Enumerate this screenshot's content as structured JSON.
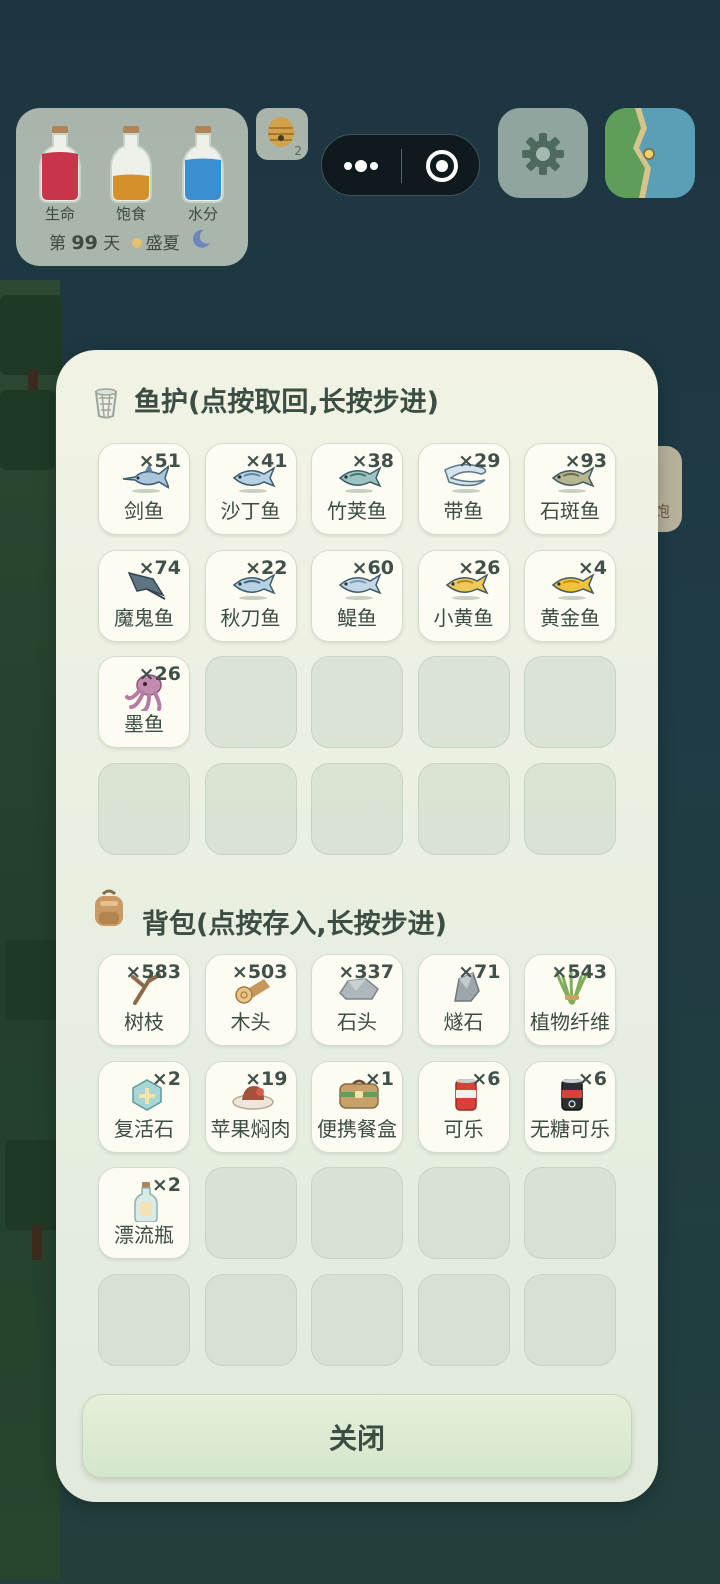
{
  "status": {
    "bottles": [
      {
        "label": "生命",
        "color": "#c8344a"
      },
      {
        "label": "饱食",
        "color": "#d4902a"
      },
      {
        "label": "水分",
        "color": "#3a8fd0"
      }
    ],
    "day_prefix": "第",
    "day_number": "99",
    "day_suffix": "天",
    "season": "盛夏"
  },
  "beehive": {
    "count": "2"
  },
  "side_panel": {
    "label": "饱"
  },
  "fish_section": {
    "title": "鱼护(点按取回,长按步进)",
    "items": [
      {
        "name": "剑鱼",
        "qty": "×51",
        "icon": "swordfish-icon"
      },
      {
        "name": "沙丁鱼",
        "qty": "×41",
        "icon": "sardine-icon"
      },
      {
        "name": "竹荚鱼",
        "qty": "×38",
        "icon": "mackerel-icon"
      },
      {
        "name": "带鱼",
        "qty": "×29",
        "icon": "beltfish-icon"
      },
      {
        "name": "石斑鱼",
        "qty": "×93",
        "icon": "grouper-icon"
      },
      {
        "name": "魔鬼鱼",
        "qty": "×74",
        "icon": "stingray-icon"
      },
      {
        "name": "秋刀鱼",
        "qty": "×22",
        "icon": "saury-icon"
      },
      {
        "name": "鳀鱼",
        "qty": "×60",
        "icon": "anchovy-icon"
      },
      {
        "name": "小黄鱼",
        "qty": "×26",
        "icon": "yellow-croaker-icon"
      },
      {
        "name": "黄金鱼",
        "qty": "×4",
        "icon": "golden-fish-icon"
      },
      {
        "name": "墨鱼",
        "qty": "×26",
        "icon": "squid-icon"
      }
    ],
    "capacity": 20
  },
  "bag_section": {
    "title": "背包(点按存入,长按步进)",
    "items": [
      {
        "name": "树枝",
        "qty": "×583",
        "icon": "branch-icon"
      },
      {
        "name": "木头",
        "qty": "×503",
        "icon": "wood-log-icon"
      },
      {
        "name": "石头",
        "qty": "×337",
        "icon": "stone-icon"
      },
      {
        "name": "燧石",
        "qty": "×71",
        "icon": "flint-icon"
      },
      {
        "name": "植物纤维",
        "qty": "×543",
        "icon": "plant-fiber-icon"
      },
      {
        "name": "复活石",
        "qty": "×2",
        "icon": "revive-stone-icon"
      },
      {
        "name": "苹果焖肉",
        "qty": "×19",
        "icon": "apple-braised-meat-icon"
      },
      {
        "name": "便携餐盒",
        "qty": "×1",
        "icon": "lunchbox-icon"
      },
      {
        "name": "可乐",
        "qty": "×6",
        "icon": "cola-can-icon"
      },
      {
        "name": "无糖可乐",
        "qty": "×6",
        "icon": "zero-cola-can-icon"
      },
      {
        "name": "漂流瓶",
        "qty": "×2",
        "icon": "drift-bottle-icon"
      }
    ],
    "capacity": 20
  },
  "close_button": {
    "label": "关闭"
  }
}
